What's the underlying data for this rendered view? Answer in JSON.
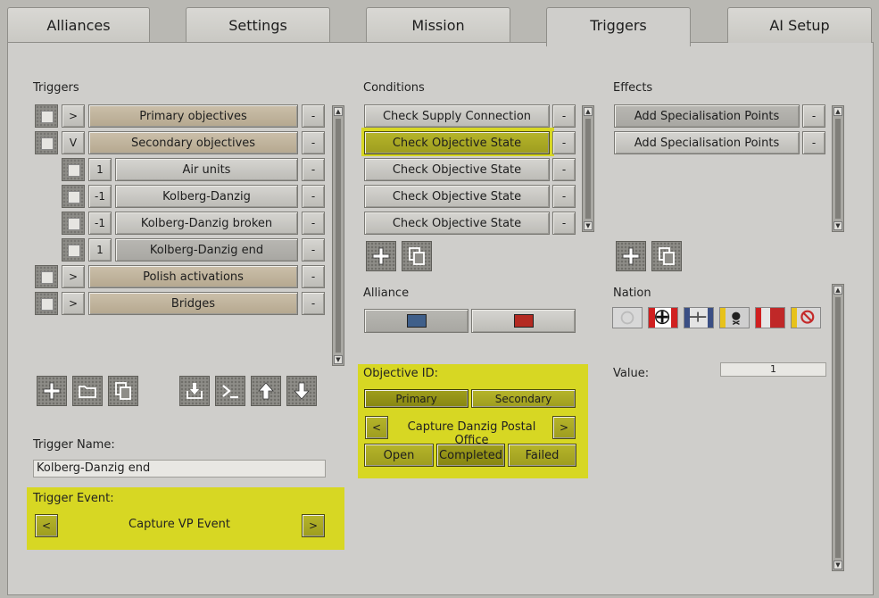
{
  "tabs": [
    "Alliances",
    "Settings",
    "Mission",
    "Triggers",
    "AI Setup"
  ],
  "triggers": {
    "label": "Triggers",
    "rows": [
      {
        "toggle": ">",
        "name": "Primary objectives",
        "minus": "-"
      },
      {
        "toggle": "V",
        "name": "Secondary objectives",
        "minus": "-"
      },
      {
        "toggle": "1",
        "name": "Air units",
        "minus": "-"
      },
      {
        "toggle": "-1",
        "name": "Kolberg-Danzig",
        "minus": "-"
      },
      {
        "toggle": "-1",
        "name": "Kolberg-Danzig broken",
        "minus": "-"
      },
      {
        "toggle": "1",
        "name": "Kolberg-Danzig end",
        "minus": "-"
      },
      {
        "toggle": ">",
        "name": "Polish activations",
        "minus": "-"
      },
      {
        "toggle": ">",
        "name": "Bridges",
        "minus": "-"
      }
    ],
    "name_label": "Trigger Name:",
    "name_value": "Kolberg-Danzig end",
    "event_label": "Trigger Event:",
    "event_value": "Capture VP Event",
    "prev": "<",
    "next": ">"
  },
  "conditions": {
    "label": "Conditions",
    "rows": [
      {
        "name": "Check Supply Connection",
        "minus": "-"
      },
      {
        "name": "Check Objective State",
        "minus": "-"
      },
      {
        "name": "Check Objective State",
        "minus": "-"
      },
      {
        "name": "Check Objective State",
        "minus": "-"
      },
      {
        "name": "Check Objective State",
        "minus": "-"
      }
    ],
    "alliance_label": "Alliance",
    "alliance_colors": [
      "#3f5f8a",
      "#b42a22"
    ],
    "objective_label": "Objective ID:",
    "primary": "Primary",
    "secondary": "Secondary",
    "objective_name": "Capture Danzig Postal Office",
    "prev": "<",
    "next": ">",
    "open": "Open",
    "completed": "Completed",
    "failed": "Failed"
  },
  "effects": {
    "label": "Effects",
    "rows": [
      {
        "name": "Add Specialisation Points",
        "minus": "-"
      },
      {
        "name": "Add Specialisation Points",
        "minus": "-"
      }
    ],
    "nation_label": "Nation",
    "value_label": "Value:",
    "value": "1"
  },
  "colors": {
    "highlight": "#d7d723",
    "olive": "#a8a724",
    "panel": "#cfcecb"
  }
}
